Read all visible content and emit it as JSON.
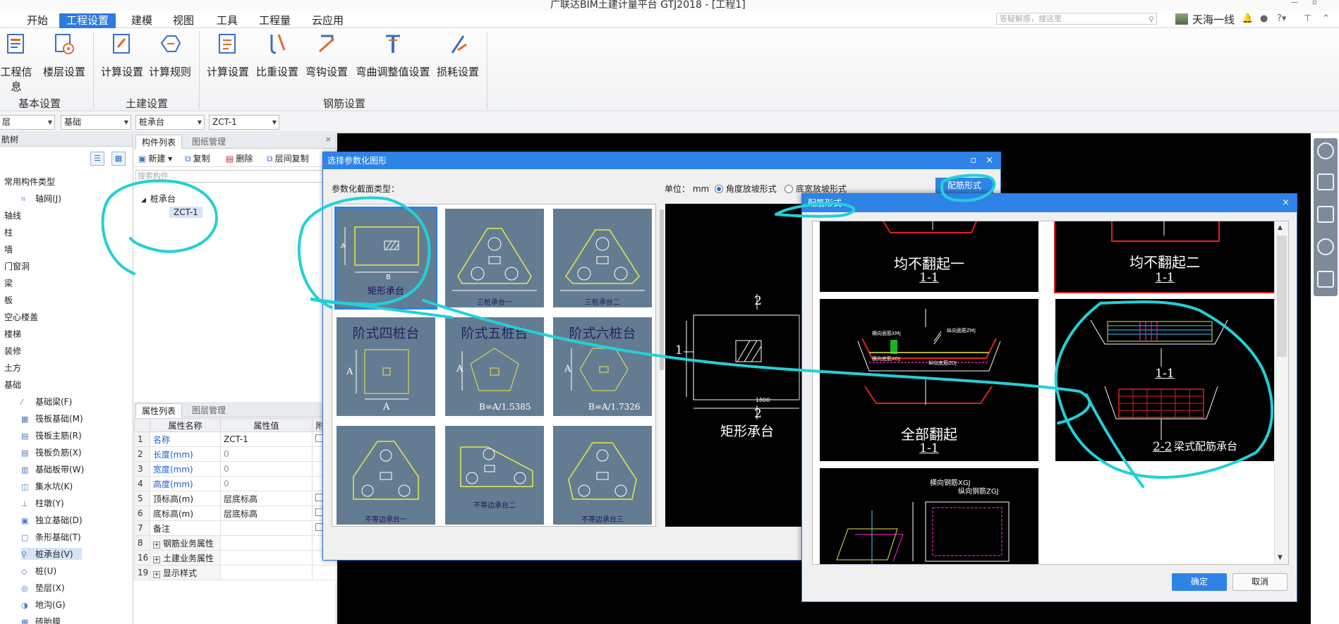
{
  "app": {
    "title": "广联达BIM土建计量平台 GTJ2018 - [工程1]",
    "menu_tabs": [
      "开始",
      "工程设置",
      "建模",
      "视图",
      "工具",
      "工程量",
      "云应用"
    ],
    "active_tab": "工程设置",
    "search_placeholder": "答疑解惑，搜这里",
    "user_name": "天海一线",
    "help_label": "?",
    "accent_color": "#2e84e6"
  },
  "ribbon": {
    "groups": [
      {
        "name": "基本设置",
        "buttons": [
          "工程信息",
          "楼层设置"
        ]
      },
      {
        "name": "土建设置",
        "buttons": [
          "计算设置",
          "计算规则"
        ]
      },
      {
        "name": "钢筋设置",
        "buttons": [
          "计算设置",
          "比重设置",
          "弯钩设置",
          "弯曲调整值设置",
          "损耗设置"
        ]
      }
    ]
  },
  "selectors": {
    "floor": "层",
    "category": "基础",
    "type": "桩承台",
    "component": "ZCT-1"
  },
  "nav_tree": {
    "title": "航树",
    "items": [
      {
        "label": "常用构件类型",
        "indent": 0
      },
      {
        "label": "轴网(J)",
        "indent": 1
      },
      {
        "label": "轴线",
        "indent": 0
      },
      {
        "label": "柱",
        "indent": 0
      },
      {
        "label": "墙",
        "indent": 0
      },
      {
        "label": "门窗洞",
        "indent": 0
      },
      {
        "label": "梁",
        "indent": 0
      },
      {
        "label": "板",
        "indent": 0
      },
      {
        "label": "空心楼盖",
        "indent": 0
      },
      {
        "label": "楼梯",
        "indent": 0
      },
      {
        "label": "装修",
        "indent": 0
      },
      {
        "label": "土方",
        "indent": 0
      },
      {
        "label": "基础",
        "indent": 0
      },
      {
        "label": "基础梁(F)",
        "indent": 1
      },
      {
        "label": "筏板基础(M)",
        "indent": 1
      },
      {
        "label": "筏板主筋(R)",
        "indent": 1
      },
      {
        "label": "筏板负筋(X)",
        "indent": 1
      },
      {
        "label": "基础板带(W)",
        "indent": 1
      },
      {
        "label": "集水坑(K)",
        "indent": 1
      },
      {
        "label": "柱墩(Y)",
        "indent": 1
      },
      {
        "label": "独立基础(D)",
        "indent": 1
      },
      {
        "label": "条形基础(T)",
        "indent": 1
      },
      {
        "label": "桩承台(V)",
        "indent": 1,
        "selected": true
      },
      {
        "label": "桩(U)",
        "indent": 1
      },
      {
        "label": "垫层(X)",
        "indent": 1
      },
      {
        "label": "地沟(G)",
        "indent": 1
      },
      {
        "label": "砖胎膜",
        "indent": 1
      }
    ]
  },
  "component_panel": {
    "tabs": [
      "构件列表",
      "图纸管理"
    ],
    "toolbar": [
      "新建",
      "复制",
      "删除",
      "层间复制"
    ],
    "search_placeholder": "搜索构件...",
    "tree_root": "桩承台",
    "tree_child": "ZCT-1"
  },
  "properties": {
    "tabs": [
      "属性列表",
      "图层管理"
    ],
    "headers": [
      "属性名称",
      "属性值",
      "附加"
    ],
    "rows": [
      {
        "no": "1",
        "name": "名称",
        "value": "ZCT-1",
        "blue": true,
        "check": true
      },
      {
        "no": "2",
        "name": "长度(mm)",
        "value": "0",
        "blue": true,
        "gray": true
      },
      {
        "no": "3",
        "name": "宽度(mm)",
        "value": "0",
        "blue": true,
        "gray": true
      },
      {
        "no": "4",
        "name": "高度(mm)",
        "value": "0",
        "blue": true,
        "gray": true
      },
      {
        "no": "5",
        "name": "顶标高(m)",
        "value": "层底标高",
        "check": true
      },
      {
        "no": "6",
        "name": "底标高(m)",
        "value": "层底标高",
        "check": true
      },
      {
        "no": "7",
        "name": "备注",
        "value": "",
        "check": true
      },
      {
        "no": "8",
        "name": "钢筋业务属性",
        "value": "",
        "expand": true
      },
      {
        "no": "16",
        "name": "土建业务属性",
        "value": "",
        "expand": true
      },
      {
        "no": "19",
        "name": "显示样式",
        "value": "",
        "expand": true
      }
    ]
  },
  "dialog_shape": {
    "title": "选择参数化图形",
    "section_label": "参数化截面类型：",
    "unit_label": "单位：",
    "unit_value": "mm",
    "radio_options": [
      "角度放坡形式",
      "底宽放坡形式"
    ],
    "rebar_button": "配筋形式",
    "shapes": [
      {
        "label": "矩形承台",
        "kind": "rect"
      },
      {
        "label": "三桩承台一",
        "kind": "tri"
      },
      {
        "label": "三桩承台二",
        "kind": "tri"
      },
      {
        "label": "阶式四桩台",
        "kind": "step4"
      },
      {
        "label": "阶式五桩台",
        "kind": "step5"
      },
      {
        "label": "阶式六桩台",
        "kind": "step6"
      },
      {
        "label": "不等边承台一",
        "kind": "uneq1"
      },
      {
        "label": "不等边承台二",
        "kind": "uneq2"
      },
      {
        "label": "不等边承台三",
        "kind": "uneq3"
      }
    ],
    "step5_formula": "B=A/1.5385",
    "step6_formula": "B=A/1.7326",
    "preview": {
      "caption": "矩形承台",
      "dim_top": "2",
      "dim_bottom": "2",
      "dim_left": "1",
      "width_label": "1800"
    }
  },
  "dialog_rebar": {
    "title": "配筋形式",
    "options": [
      {
        "label": "均不翻起一",
        "section": "1-1"
      },
      {
        "label": "均不翻起二",
        "section": "1-1",
        "selected": true
      },
      {
        "label": "全部翻起",
        "section": "1-1"
      },
      {
        "label": "梁式配筋承台",
        "section": "2-2",
        "section_top": "1-1"
      },
      {
        "label": "",
        "section": ""
      }
    ],
    "rebar_labels": [
      "横向钢筋XGJ",
      "纵向钢筋ZGJ",
      "横向面筋XMJ",
      "纵向面筋ZMJ",
      "横向底筋XDJ",
      "纵向底筋ZDJ"
    ],
    "ok_label": "确定",
    "cancel_label": "取消"
  },
  "annotation_color": "#22d0d8"
}
